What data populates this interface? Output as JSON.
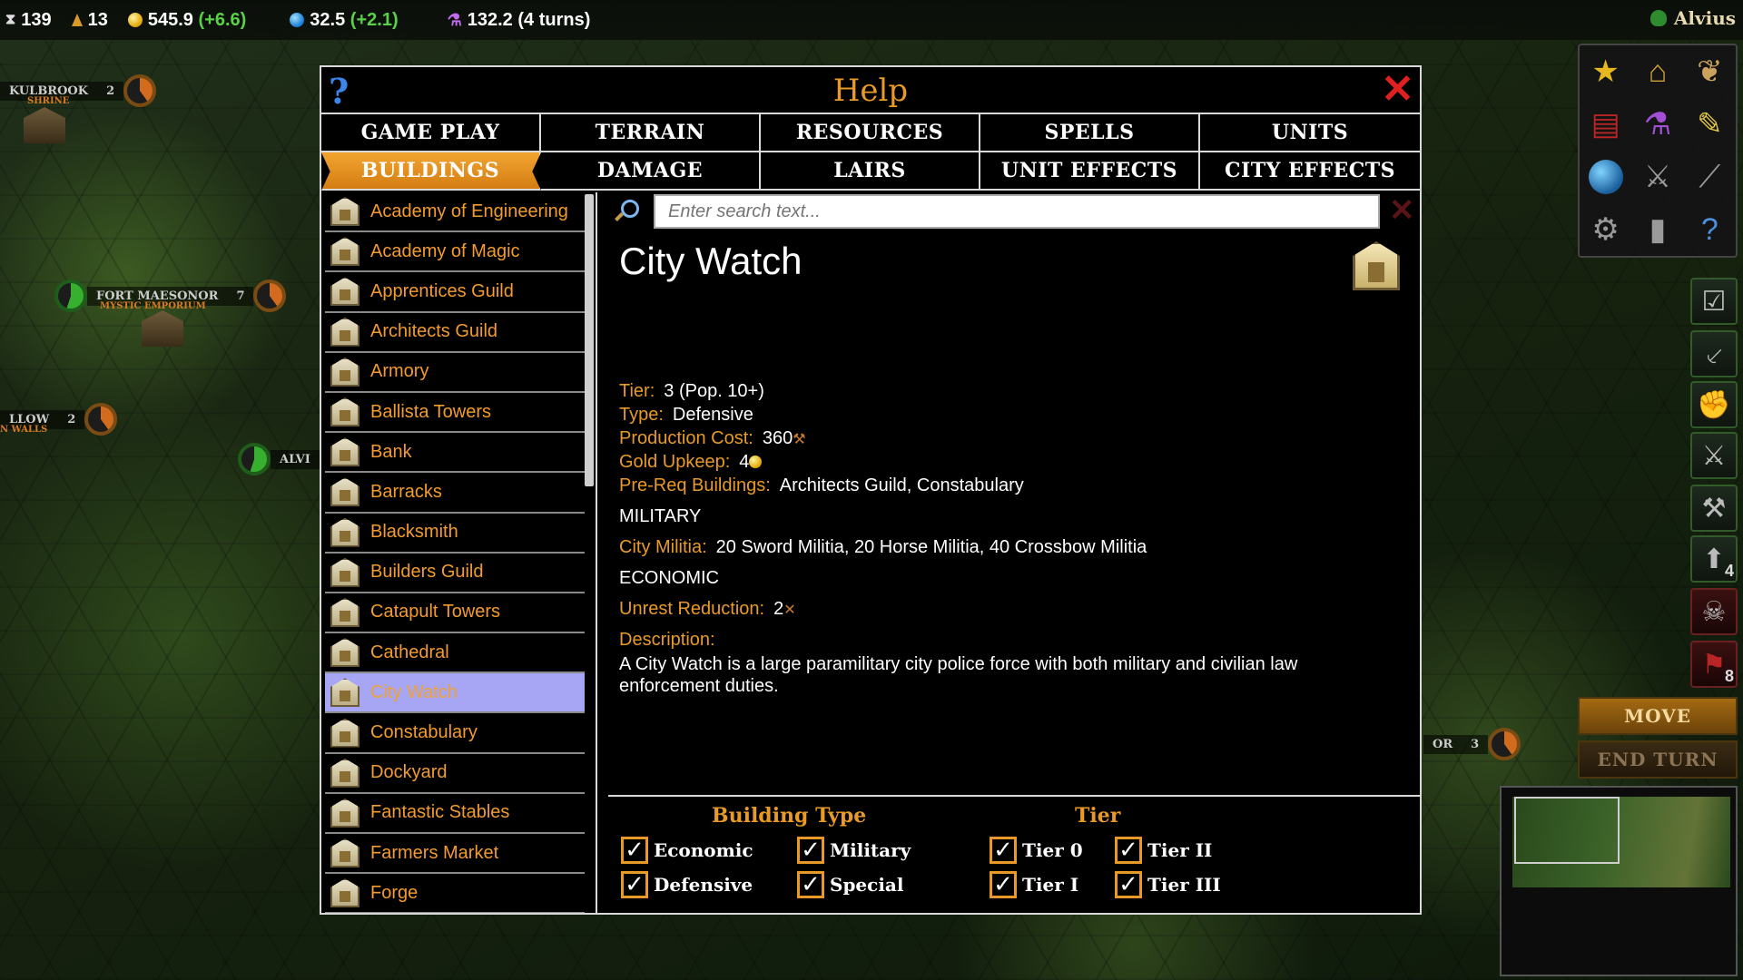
{
  "topbar": {
    "turns": "139",
    "population": "13",
    "gold": "545.9",
    "gold_delta": "(+6.6)",
    "mana": "32.5",
    "mana_delta": "(+2.1)",
    "research": "132.2 (4 turns)",
    "player_name": "Alvius"
  },
  "map": {
    "city1_name": "Kulbrook",
    "city1_pop": "2",
    "city1_type": "Shrine",
    "city2_name": "Fort Maesonor",
    "city2_pop": "7",
    "city2_type": "Mystic Emporium",
    "city3_name": "llow",
    "city3_pop": "2",
    "city3_type": "n walls",
    "city4_name": "Alvi",
    "city5_name": "or",
    "city5_pop": "3"
  },
  "side": {
    "move_label": "MOVE",
    "end_turn_label": "END TURN",
    "badge_count": "4",
    "flag_count": "8"
  },
  "help": {
    "title": "Help",
    "tabs": [
      "GAME PLAY",
      "TERRAIN",
      "RESOURCES",
      "SPELLS",
      "UNITS",
      "BUILDINGS",
      "DAMAGE",
      "LAIRS",
      "UNIT EFFECTS",
      "CITY EFFECTS"
    ],
    "buildings": [
      "Academy of Engineering",
      "Academy of Magic",
      "Apprentices Guild",
      "Architects Guild",
      "Armory",
      "Ballista Towers",
      "Bank",
      "Barracks",
      "Blacksmith",
      "Builders Guild",
      "Catapult Towers",
      "Cathedral",
      "City Watch",
      "Constabulary",
      "Dockyard",
      "Fantastic Stables",
      "Farmers Market",
      "Forge"
    ],
    "search_placeholder": "Enter search text...",
    "detail": {
      "name": "City Watch",
      "tier_label": "Tier:",
      "tier_value": "3 (Pop. 10+)",
      "type_label": "Type:",
      "type_value": "Defensive",
      "production_label": "Production Cost:",
      "production_value": "360",
      "upkeep_label": "Gold Upkeep:",
      "upkeep_value": "4",
      "prereq_label": "Pre-Req Buildings:",
      "prereq_value": "Architects Guild, Constabulary",
      "military_header": "MILITARY",
      "militia_label": "City Militia:",
      "militia_value": "20 Sword Militia, 20 Horse Militia, 40 Crossbow Militia",
      "economic_header": "ECONOMIC",
      "unrest_label": "Unrest Reduction:",
      "unrest_value": "2",
      "description_label": "Description:",
      "description_value": "A City Watch is a large paramilitary city police force with both military and civilian law enforcement duties."
    },
    "filters": {
      "building_type_header": "Building Type",
      "tier_header": "Tier",
      "economic": "Economic",
      "military": "Military",
      "defensive": "Defensive",
      "special": "Special",
      "tier0": "Tier 0",
      "tier1": "Tier I",
      "tier2": "Tier II",
      "tier3": "Tier III",
      "check_mark": "✓"
    }
  },
  "colors": {
    "accent_orange": "#e99a26",
    "selected_row": "#a7a6f5",
    "close_red": "#e02020",
    "help_blue": "#3b86e8"
  }
}
